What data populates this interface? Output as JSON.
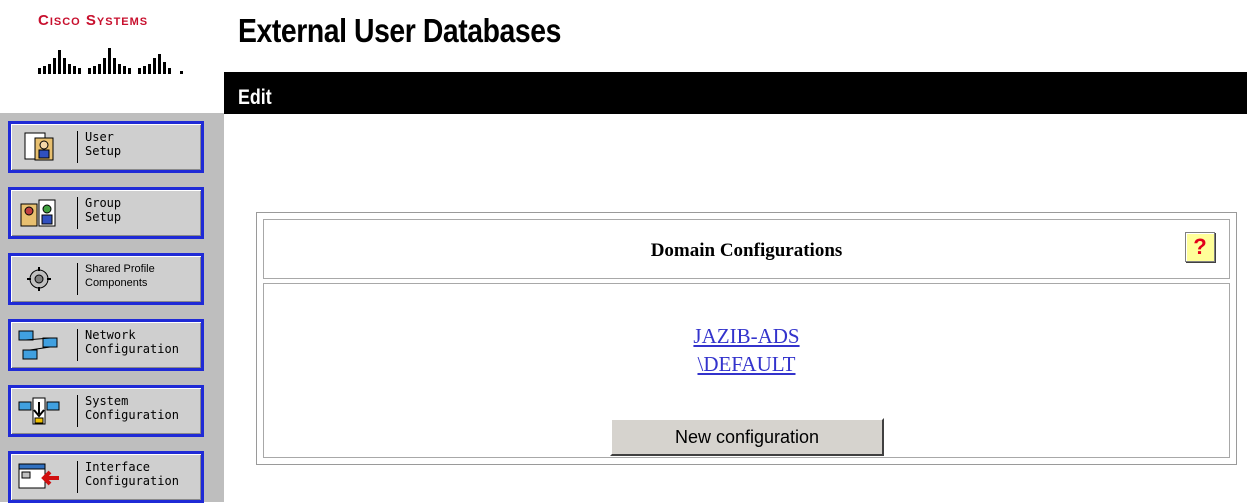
{
  "brand": {
    "name": "Cisco Systems",
    "color": "#c8102e"
  },
  "header": {
    "title": "External User Databases"
  },
  "section_bar": {
    "label": "Edit"
  },
  "sidebar": {
    "items": [
      {
        "label": "User\nSetup",
        "icon": "user-setup-icon"
      },
      {
        "label": "Group\nSetup",
        "icon": "group-setup-icon"
      },
      {
        "label": "Shared Profile\nComponents",
        "icon": "shared-profile-icon"
      },
      {
        "label": "Network\nConfiguration",
        "icon": "network-config-icon"
      },
      {
        "label": "System\nConfiguration",
        "icon": "system-config-icon"
      },
      {
        "label": "Interface\nConfiguration",
        "icon": "interface-config-icon"
      }
    ]
  },
  "panel": {
    "title": "Domain Configurations",
    "help": "?",
    "domains": [
      "JAZIB-ADS",
      "\\DEFAULT"
    ],
    "new_button": "New configuration"
  },
  "colors": {
    "nav_border": "#1f2ad6",
    "link": "#3333cc",
    "help_bg": "#ffff99"
  }
}
